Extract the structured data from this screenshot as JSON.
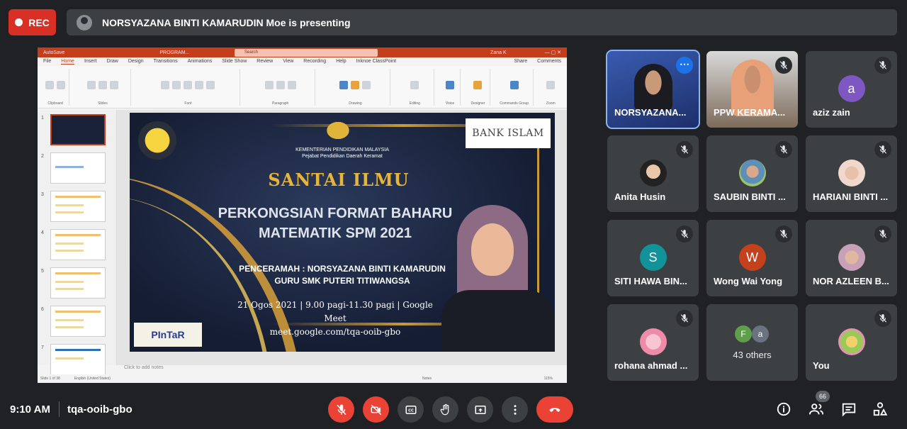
{
  "top_bar": {
    "rec_label": "REC",
    "presenting_text": "NORSYAZANA BINTI KAMARUDIN Moe is presenting"
  },
  "shared_screen": {
    "ppt": {
      "title_bar": [
        "AutoSave",
        "PROGRAM...",
        "Zana K"
      ],
      "search_placeholder": "Search",
      "tabs": [
        "File",
        "Home",
        "Insert",
        "Draw",
        "Design",
        "Transitions",
        "Animations",
        "Slide Show",
        "Review",
        "View",
        "Recording",
        "Help",
        "Inknoe ClassPoint"
      ],
      "active_tab": "Home",
      "ribbon_groups": [
        "Clipboard",
        "Slides",
        "Font",
        "Paragraph",
        "Drawing",
        "Editing",
        "Voice",
        "Designer",
        "Commands Group",
        "Zoom"
      ],
      "share_label": "Share",
      "comments_label": "Comments",
      "thumb_numbers": [
        "1",
        "2",
        "3",
        "4",
        "5",
        "6",
        "7"
      ],
      "notes_placeholder": "Click to add notes",
      "status_left": "Slide 1 of 38",
      "status_lang": "English (United States)",
      "status_notes": "Notes",
      "status_zoom": "115%"
    },
    "slide": {
      "ministry": "KEMENTERIAN PENDIDIKAN MALAYSIA",
      "office": "Pejabat Pendidikan Daerah Keramat",
      "sponsor": "BANK ISLAM",
      "title": "SANTAI ILMU",
      "subtitle_line1": "PERKONGSIAN FORMAT BAHARU",
      "subtitle_line2": "MATEMATIK SPM 2021",
      "speaker_line1": "PENCERAMAH :  NORSYAZANA BINTI KAMARUDIN",
      "speaker_line2": "GURU SMK PUTERI TITIWANGSA",
      "date_line": "21 Ogos 2021 | 9.00 pagi-11.30 pagi | Google Meet",
      "link_line": "meet.google.com/tqa-ooib-gbo",
      "pintar_logo": "PInTaR"
    }
  },
  "participants": [
    {
      "name": "NORSYAZANA...",
      "kind": "video",
      "active": true
    },
    {
      "name": "PPW KERAMA...",
      "kind": "video",
      "muted": true
    },
    {
      "name": "aziz zain",
      "kind": "letter",
      "letter": "a",
      "color": "#7e57c2",
      "muted": true
    },
    {
      "name": "Anita Husin",
      "kind": "photo",
      "muted": true
    },
    {
      "name": "SAUBIN BINTI ...",
      "kind": "photo",
      "muted": true
    },
    {
      "name": "HARIANI BINTI ...",
      "kind": "photo",
      "muted": true
    },
    {
      "name": "SITI HAWA BIN...",
      "kind": "letter",
      "letter": "S",
      "color": "#12939a",
      "muted": true
    },
    {
      "name": "Wong Wai Yong",
      "kind": "letter",
      "letter": "W",
      "color": "#c5411c",
      "muted": true
    },
    {
      "name": "NOR AZLEEN B...",
      "kind": "photo",
      "muted": true
    },
    {
      "name": "rohana ahmad ...",
      "kind": "photo",
      "muted": true
    },
    {
      "name": "43 others",
      "kind": "others",
      "letters": [
        "F",
        "a"
      ]
    },
    {
      "name": "You",
      "kind": "photo",
      "muted": true
    }
  ],
  "bottom_bar": {
    "time": "9:10 AM",
    "meeting_code": "tqa-ooib-gbo",
    "controls": [
      "mic-off-icon",
      "camera-off-icon",
      "captions-icon",
      "raise-hand-icon",
      "present-icon",
      "more-options-icon",
      "end-call-icon"
    ],
    "right_icons": [
      "info-icon",
      "people-icon",
      "chat-icon",
      "activities-icon"
    ],
    "participant_count": "66"
  },
  "colors": {
    "background": "#202124",
    "tile": "#3c4043",
    "red": "#ea4335",
    "active_outline": "#8ab4f8"
  }
}
